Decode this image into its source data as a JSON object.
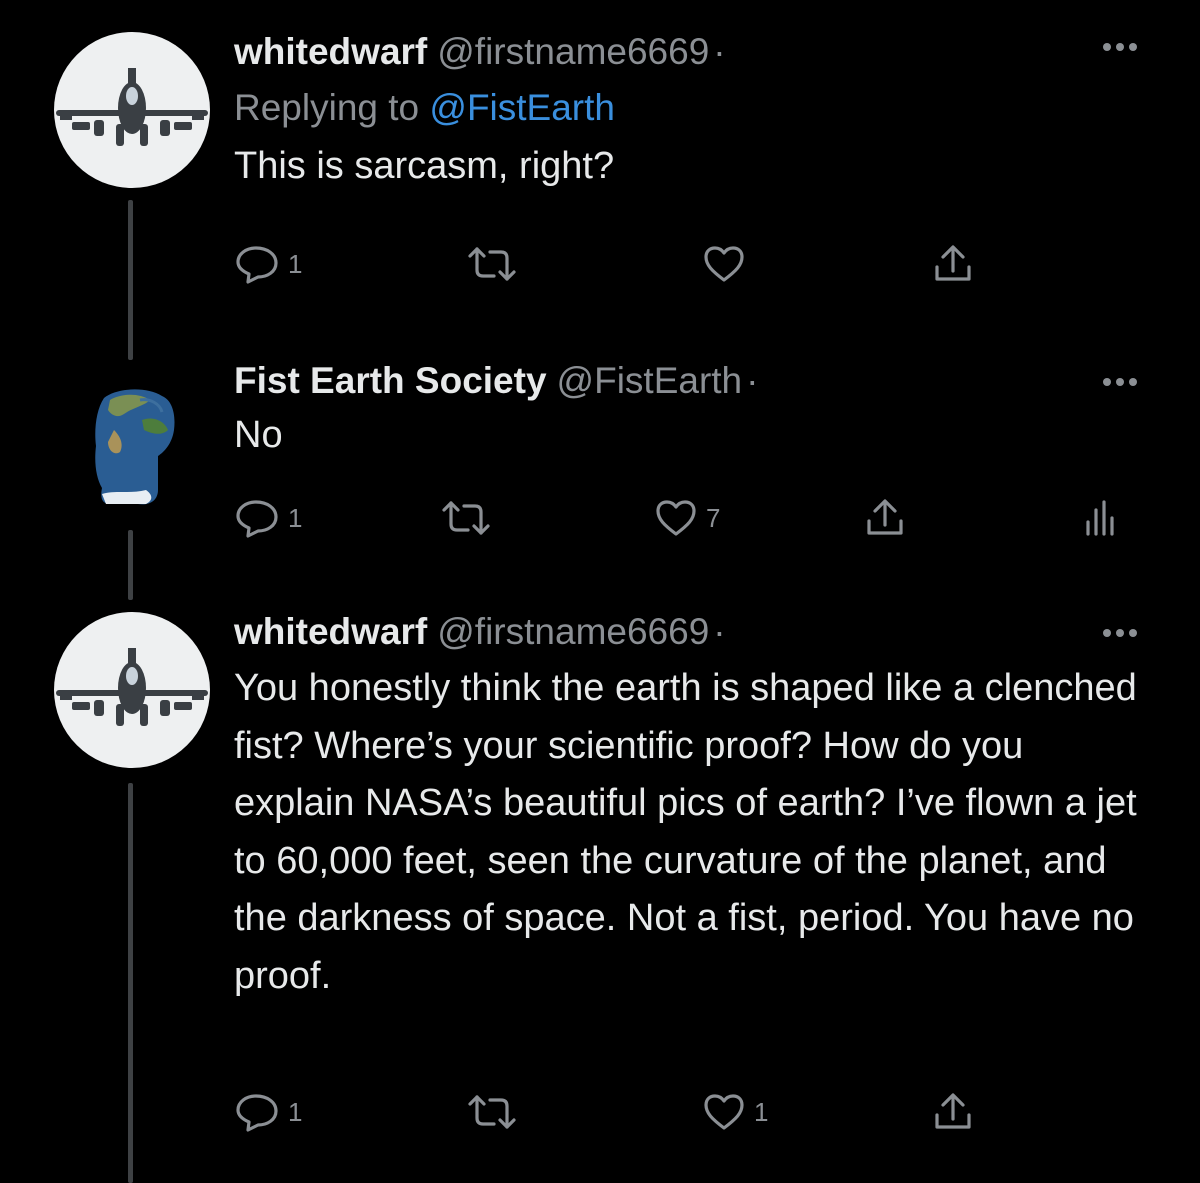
{
  "tweets": [
    {
      "name": "whitedwarf",
      "handle": "@firstname6669",
      "dot": "·",
      "replying_prefix": "Replying to",
      "replying_to": "@FistEarth",
      "text": "This is sarcasm, right?",
      "reply_count": "1",
      "like_count": ""
    },
    {
      "name": "Fist Earth Society",
      "handle": "@FistEarth",
      "dot": "·",
      "text": "No",
      "reply_count": "1",
      "like_count": "7"
    },
    {
      "name": "whitedwarf",
      "handle": "@firstname6669",
      "dot": "·",
      "text": "You honestly think the earth is shaped like a clenched fist? Where’s your scientific proof? How do you explain NASA’s beautiful pics of earth? I’ve flown a jet to 60,000 feet, seen the curvature of the planet, and the darkness of space. Not a fist, period. You have no proof.",
      "reply_count": "1",
      "like_count": "1"
    }
  ],
  "icons": {
    "more": "more-horizontal-icon",
    "reply": "reply-bubble-icon",
    "retweet": "retweet-icon",
    "like": "heart-icon",
    "share": "share-upload-icon",
    "analytics": "analytics-bars-icon"
  },
  "colors": {
    "background": "#000000",
    "text": "#e7e9ea",
    "muted": "#8b8f94",
    "link": "#3a8fde",
    "thread_line": "#3e4144"
  }
}
